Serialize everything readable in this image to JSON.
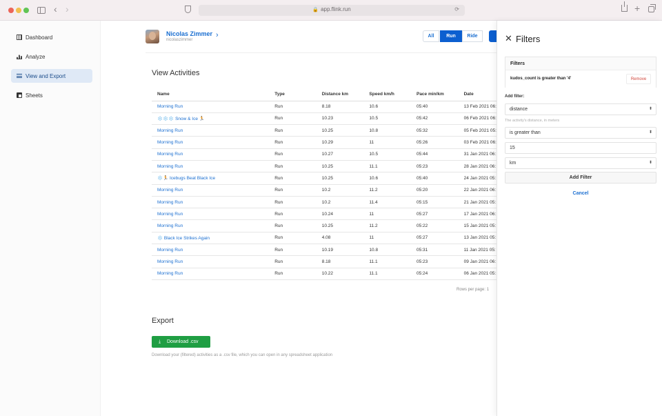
{
  "browser": {
    "url": "app.flink.run"
  },
  "sidebar": {
    "items": [
      {
        "label": "Dashboard"
      },
      {
        "label": "Analyze"
      },
      {
        "label": "View and Export"
      },
      {
        "label": "Sheets"
      }
    ]
  },
  "profile": {
    "name": "Nicolas Zimmer",
    "handle": "nicolaszimmer"
  },
  "activity_filters": {
    "all": "All",
    "run": "Run",
    "ride": "Ride"
  },
  "activities": {
    "title": "View Activities",
    "columns": [
      "Name",
      "Type",
      "Distance km",
      "Speed km/h",
      "Pace min/km",
      "Date"
    ],
    "rows": [
      [
        "Morning Run",
        "Run",
        "8.18",
        "10.6",
        "05:40",
        "13 Feb 2021 06:"
      ],
      [
        "❄️❄️❄️ Snow & Ice 🏃",
        "Run",
        "10.23",
        "10.5",
        "05:42",
        "06 Feb 2021 06:"
      ],
      [
        "Morning Run",
        "Run",
        "10.25",
        "10.8",
        "05:32",
        "05 Feb 2021 05:"
      ],
      [
        "Morning Run",
        "Run",
        "10.29",
        "11",
        "05:26",
        "03 Feb 2021 06:"
      ],
      [
        "Morning Run",
        "Run",
        "10.27",
        "10.5",
        "05:44",
        "31 Jan 2021 06:"
      ],
      [
        "Morning Run",
        "Run",
        "10.25",
        "11.1",
        "05:23",
        "28 Jan 2021 06:"
      ],
      [
        "❄️🏃 Icebugs Beat Black Ice",
        "Run",
        "10.25",
        "10.6",
        "05:40",
        "24 Jan 2021 05:"
      ],
      [
        "Morning Run",
        "Run",
        "10.2",
        "11.2",
        "05:20",
        "22 Jan 2021 06:"
      ],
      [
        "Morning Run",
        "Run",
        "10.2",
        "11.4",
        "05:15",
        "21 Jan 2021 05:"
      ],
      [
        "Morning Run",
        "Run",
        "10.24",
        "11",
        "05:27",
        "17 Jan 2021 06:"
      ],
      [
        "Morning Run",
        "Run",
        "10.25",
        "11.2",
        "05:22",
        "15 Jan 2021 05:"
      ],
      [
        "❄️ Black Ice Strikes Again",
        "Run",
        "4.08",
        "11",
        "05:27",
        "13 Jan 2021 05:"
      ],
      [
        "Morning Run",
        "Run",
        "10.19",
        "10.8",
        "05:31",
        "11 Jan 2021 05:"
      ],
      [
        "Morning Run",
        "Run",
        "8.18",
        "11.1",
        "05:23",
        "09 Jan 2021 06:"
      ],
      [
        "Morning Run",
        "Run",
        "10.22",
        "11.1",
        "05:24",
        "06 Jan 2021 05:"
      ]
    ],
    "rows_per_page_label": "Rows per page:",
    "rows_per_page_value": "1"
  },
  "export": {
    "title": "Export",
    "button_label": "Download .csv",
    "description": "Download your (filtered) activities as a .csv file, which you can open in any spreadsheet application"
  },
  "filters_panel": {
    "title": "Filters",
    "box_title": "Filters",
    "active_filter": "kudos_count is greater than '4'",
    "remove_label": "Remove",
    "add_filter_label": "Add filter:",
    "field_select": "distance",
    "field_hint": "The activity's distance, in meters",
    "operator_select": "is greater than",
    "value_input": "15",
    "unit_select": "km",
    "add_button": "Add Filter",
    "cancel": "Cancel"
  },
  "colors": {
    "accent": "#0c5fd0",
    "link": "#1b6fd1",
    "export_green": "#1f9e43",
    "remove_red": "#d0453a"
  }
}
